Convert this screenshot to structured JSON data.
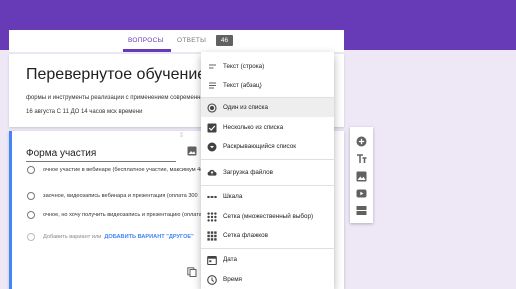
{
  "tabs": {
    "questions_label": "ВОПРОСЫ",
    "answers_label": "ОТВЕТЫ",
    "answers_count": "46"
  },
  "form": {
    "title": "Перевернутое обучение",
    "description": "формы и инструменты реализации с применением современных",
    "date": "16 августа  С 11  ДО 14  часов мск времени"
  },
  "question": {
    "title": "Форма участия",
    "options": [
      "очное участие в вебинаре (бесплатное участие,  максимум 4(",
      "заочное,  видеозапись вебинара и презентация  (оплата 300",
      "очное, но хочу получить видеозапись и презентацию (оплата"
    ],
    "add_option_text": "Добавить вариант  или",
    "add_other_label": "ДОБАВИТЬ ВАРИАНТ \"ДРУГОЕ\""
  },
  "menu": {
    "items": [
      {
        "label": "Текст (строка)",
        "icon": "short-text-icon"
      },
      {
        "label": "Текст (абзац)",
        "icon": "paragraph-icon"
      },
      {
        "label": "Один из списка",
        "icon": "radio-button-icon"
      },
      {
        "label": "Несколько из списка",
        "icon": "checkbox-icon"
      },
      {
        "label": "Раскрывающийся список",
        "icon": "dropdown-icon"
      },
      {
        "label": "Загрузка файлов",
        "icon": "cloud-upload-icon"
      },
      {
        "label": "Шкала",
        "icon": "linear-scale-icon"
      },
      {
        "label": "Сетка (множественный выбор)",
        "icon": "grid-radio-icon"
      },
      {
        "label": "Сетка флажков",
        "icon": "grid-checkbox-icon"
      },
      {
        "label": "Дата",
        "icon": "calendar-icon"
      },
      {
        "label": "Время",
        "icon": "clock-icon"
      }
    ],
    "selected": "Один из списка"
  },
  "toolbar": {
    "tools": [
      "add-question-icon",
      "title-text-icon",
      "image-icon",
      "video-icon",
      "section-icon"
    ]
  },
  "colors": {
    "brand": "#673ab7",
    "background": "#ede7f6",
    "accent": "#4285f4"
  }
}
